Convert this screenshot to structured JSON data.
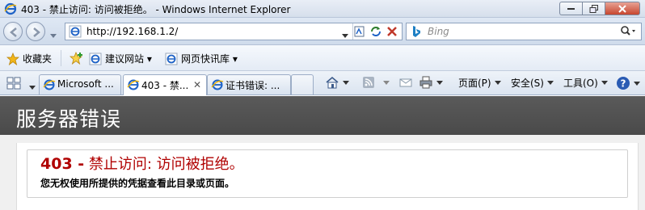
{
  "window": {
    "title": "403 - 禁止访问: 访问被拒绝。 - Windows Internet Explorer"
  },
  "address_bar": {
    "url": "http://192.168.1.2/",
    "search_placeholder": "Bing"
  },
  "favorites_bar": {
    "favorites_label": "收藏夹",
    "items": [
      {
        "label": "建议网站 ▾"
      },
      {
        "label": "网页快讯库 ▾"
      }
    ]
  },
  "tabs": [
    {
      "label": "Microsoft ..."
    },
    {
      "label": "403 - 禁...",
      "active": true
    },
    {
      "label": "证书错误: ..."
    }
  ],
  "command_bar": {
    "page_label": "页面(P)",
    "safety_label": "安全(S)",
    "tools_label": "工具(O)"
  },
  "page": {
    "heading": "服务器错误",
    "error_code": "403 -",
    "error_title": " 禁止访问: 访问被拒绝。",
    "error_message": "您无权使用所提供的凭据查看此目录或页面。"
  },
  "colors": {
    "error_red": "#b00000",
    "header_gray": "#4f4f4f",
    "ie_blue": "#1e62c6"
  }
}
